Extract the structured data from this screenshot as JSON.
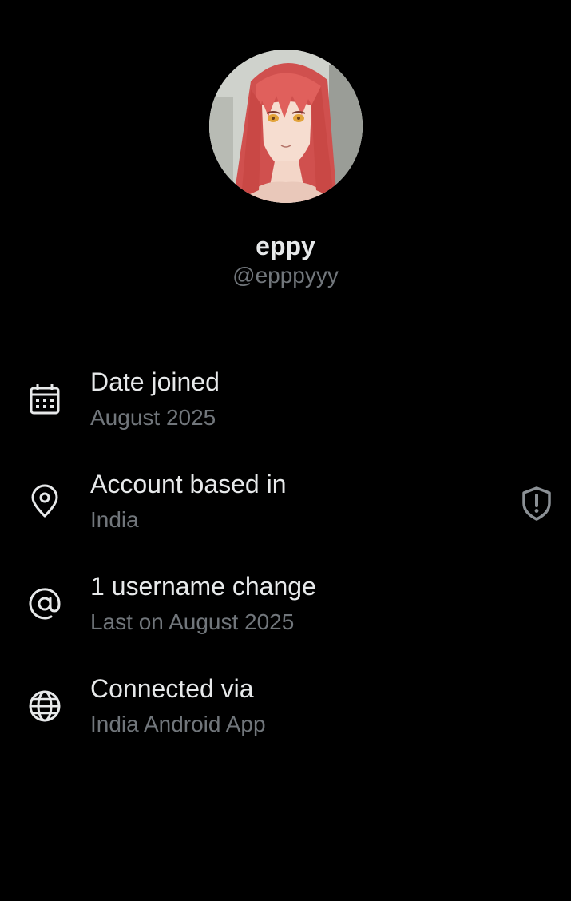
{
  "profile": {
    "display_name": "eppy",
    "handle": "@epppyyy",
    "avatar_icon": "anime-avatar"
  },
  "colors": {
    "background": "#000000",
    "primary_text": "#e7e9ea",
    "secondary_text": "#71767b"
  },
  "info": [
    {
      "icon": "calendar-icon",
      "title": "Date joined",
      "subtitle": "August 2025"
    },
    {
      "icon": "location-pin-icon",
      "title": "Account based in",
      "subtitle": "India",
      "trailing_icon": "shield-alert-icon"
    },
    {
      "icon": "at-sign-icon",
      "title": "1 username change",
      "subtitle": "Last on August 2025"
    },
    {
      "icon": "globe-icon",
      "title": "Connected via",
      "subtitle": "India Android App"
    }
  ]
}
